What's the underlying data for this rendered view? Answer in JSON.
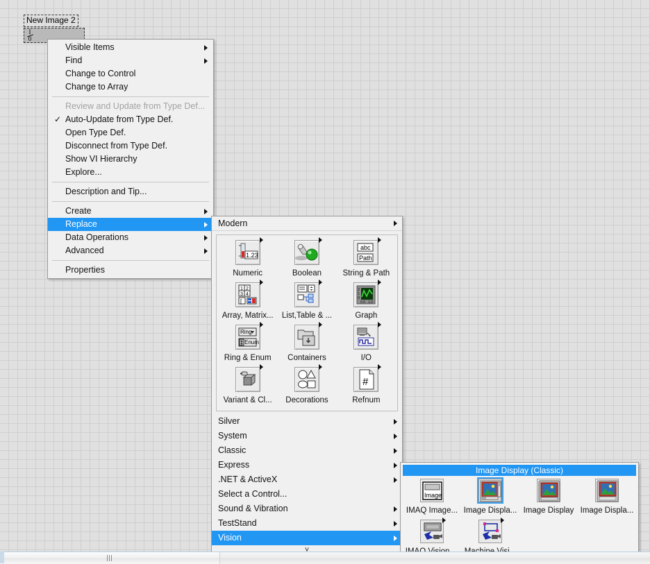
{
  "control": {
    "label": "New Image 2",
    "glyph_name": "refnum-io-glyph",
    "glyph_top": "I",
    "glyph_bottom": "0"
  },
  "context_menu": {
    "items": [
      {
        "label": "Visible Items",
        "submenu": true,
        "checked": false,
        "disabled": false,
        "selected": false
      },
      {
        "label": "Find",
        "submenu": true,
        "checked": false,
        "disabled": false,
        "selected": false
      },
      {
        "label": "Change to Control",
        "submenu": false,
        "checked": false,
        "disabled": false,
        "selected": false
      },
      {
        "label": "Change to Array",
        "submenu": false,
        "checked": false,
        "disabled": false,
        "selected": false
      },
      {
        "separator": true
      },
      {
        "label": "Review and Update from Type Def...",
        "submenu": false,
        "checked": false,
        "disabled": true,
        "selected": false
      },
      {
        "label": "Auto-Update from Type Def.",
        "submenu": false,
        "checked": true,
        "disabled": false,
        "selected": false
      },
      {
        "label": "Open Type Def.",
        "submenu": false,
        "checked": false,
        "disabled": false,
        "selected": false
      },
      {
        "label": "Disconnect from Type Def.",
        "submenu": false,
        "checked": false,
        "disabled": false,
        "selected": false
      },
      {
        "label": "Show VI Hierarchy",
        "submenu": false,
        "checked": false,
        "disabled": false,
        "selected": false
      },
      {
        "label": "Explore...",
        "submenu": false,
        "checked": false,
        "disabled": false,
        "selected": false
      },
      {
        "separator": true
      },
      {
        "label": "Description and Tip...",
        "submenu": false,
        "checked": false,
        "disabled": false,
        "selected": false
      },
      {
        "separator": true
      },
      {
        "label": "Create",
        "submenu": true,
        "checked": false,
        "disabled": false,
        "selected": false
      },
      {
        "label": "Replace",
        "submenu": true,
        "checked": false,
        "disabled": false,
        "selected": true
      },
      {
        "label": "Data Operations",
        "submenu": true,
        "checked": false,
        "disabled": false,
        "selected": false
      },
      {
        "label": "Advanced",
        "submenu": true,
        "checked": false,
        "disabled": false,
        "selected": false
      },
      {
        "separator": true
      },
      {
        "label": "Properties",
        "submenu": false,
        "checked": false,
        "disabled": false,
        "selected": false
      }
    ],
    "check_glyph": "✓"
  },
  "palette": {
    "header": {
      "label": "Modern",
      "submenu": true
    },
    "icons": [
      {
        "label": "Numeric",
        "icon": "numeric-icon",
        "submenu": true
      },
      {
        "label": "Boolean",
        "icon": "boolean-icon",
        "submenu": true
      },
      {
        "label": "String & Path",
        "icon": "string-path-icon",
        "submenu": true
      },
      {
        "label": "Array, Matrix...",
        "icon": "array-matrix-icon",
        "submenu": true
      },
      {
        "label": "List,Table & ...",
        "icon": "list-table-icon",
        "submenu": true
      },
      {
        "label": "Graph",
        "icon": "graph-icon",
        "submenu": true
      },
      {
        "label": "Ring & Enum",
        "icon": "ring-enum-icon",
        "submenu": true
      },
      {
        "label": "Containers",
        "icon": "containers-icon",
        "submenu": true
      },
      {
        "label": "I/O",
        "icon": "io-icon",
        "submenu": true
      },
      {
        "label": "Variant & Cl...",
        "icon": "variant-class-icon",
        "submenu": true
      },
      {
        "label": "Decorations",
        "icon": "decorations-icon",
        "submenu": true
      },
      {
        "label": "Refnum",
        "icon": "refnum-icon",
        "submenu": true
      }
    ],
    "categories": [
      {
        "label": "Silver",
        "submenu": true,
        "selected": false
      },
      {
        "label": "System",
        "submenu": true,
        "selected": false
      },
      {
        "label": "Classic",
        "submenu": true,
        "selected": false
      },
      {
        "label": "Express",
        "submenu": true,
        "selected": false
      },
      {
        "label": ".NET & ActiveX",
        "submenu": true,
        "selected": false
      },
      {
        "label": "Select a Control...",
        "submenu": false,
        "selected": false
      },
      {
        "label": "Sound & Vibration",
        "submenu": true,
        "selected": false
      },
      {
        "label": "TestStand",
        "submenu": true,
        "selected": false
      },
      {
        "label": "Vision",
        "submenu": true,
        "selected": true
      }
    ],
    "more_glyph": "˅"
  },
  "vision_panel": {
    "title": "Image Display (Classic)",
    "items": [
      {
        "label": "IMAQ Image...",
        "icon": "imaq-image-icon",
        "submenu": false,
        "selected": false
      },
      {
        "label": "Image Displa...",
        "icon": "image-display-classic-icon",
        "submenu": false,
        "selected": true
      },
      {
        "label": "Image Display",
        "icon": "image-display-icon",
        "submenu": false,
        "selected": false
      },
      {
        "label": "Image Displa...",
        "icon": "image-display-alt-icon",
        "submenu": false,
        "selected": false
      },
      {
        "label": "IMAQ Vision ...",
        "icon": "imaq-vision-icon",
        "submenu": true,
        "selected": false
      },
      {
        "label": "Machine Visi...",
        "icon": "machine-vision-icon",
        "submenu": true,
        "selected": false
      }
    ]
  },
  "scrollbar": {
    "orientation": "horizontal",
    "grip": "grip-icon"
  },
  "colors": {
    "highlight_blue": "#2196f3",
    "menu_bg": "#f0f0f0",
    "canvas_bg": "#e0e0e0",
    "grid_line": "#cfcfcf",
    "disabled_text": "#a2a2a2"
  }
}
